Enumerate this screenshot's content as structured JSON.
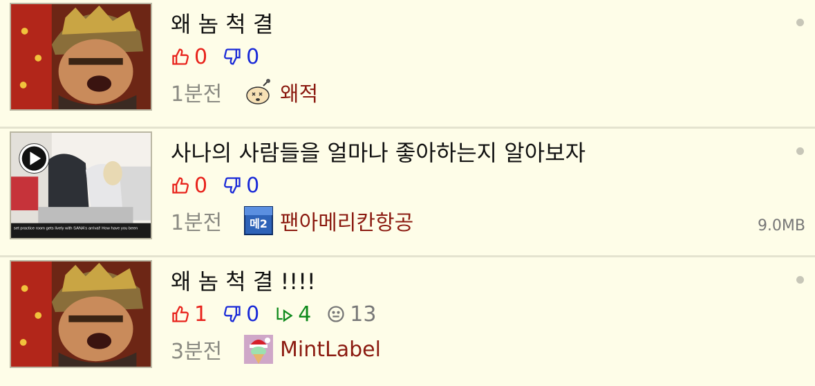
{
  "posts": [
    {
      "title": "왜 놈 척 결",
      "thumbnail": "man-in-hat-image",
      "upvotes": "0",
      "downvotes": "0",
      "time": "1분전",
      "author": "왜적",
      "avatar": "bomb-face-icon"
    },
    {
      "title": "사나의 사람들을 얼마나 좋아하는지 알아보자",
      "thumbnail": "dance-practice-video",
      "thumbnail_caption": "set practice room gets lively with SANA's arrival! How have you been",
      "upvotes": "0",
      "downvotes": "0",
      "time": "1분전",
      "author": "팬아메리칸항공",
      "avatar": "me2-badge-icon",
      "avatar_text": "메2",
      "file_size": "9.0MB"
    },
    {
      "title": "왜 놈 척 결 !!!!",
      "thumbnail": "man-in-hat-image",
      "upvotes": "1",
      "downvotes": "0",
      "replies": "4",
      "views": "13",
      "time": "3분전",
      "author": "MintLabel",
      "avatar": "ice-cream-santa-icon"
    }
  ],
  "colors": {
    "background": "#fefde8",
    "upvote": "#e8221b",
    "downvote": "#1a2ad8",
    "reply": "#0e8a1c",
    "author": "#8b1a10",
    "time": "#8a8a82"
  }
}
